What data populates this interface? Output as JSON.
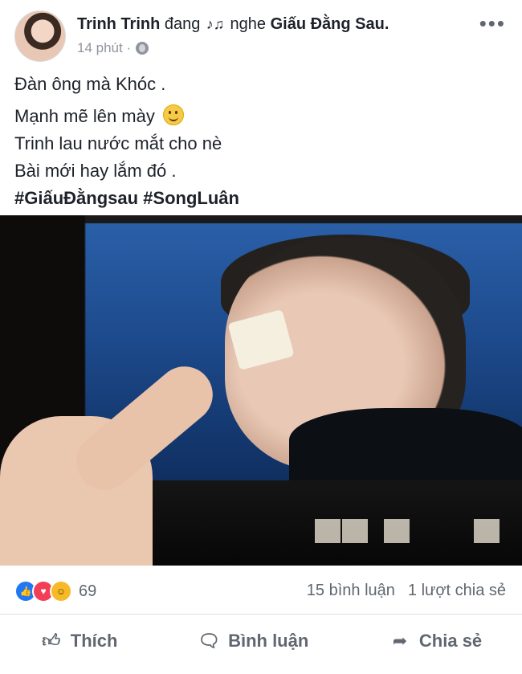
{
  "post": {
    "author": "Trinh Trinh",
    "activity_verb": "đang",
    "activity_text": "nghe",
    "song": "Giấu Đằng Sau.",
    "time": "14 phút ·",
    "more_label": "•••",
    "text_lines": [
      "Đàn ông mà Khóc .",
      "Mạnh mẽ lên mày",
      "Trinh lau nước mắt cho nè",
      "Bài mới hay lắm đó .",
      "#GiấuĐằngsau #SongLuân"
    ]
  },
  "stats": {
    "reaction_count": "69",
    "comments": "15 bình luận",
    "shares": "1 lượt chia sẻ"
  },
  "actions": {
    "like": "Thích",
    "comment": "Bình luận",
    "share": "Chia sẻ"
  },
  "icons": [
    "music-note-icon",
    "globe-icon",
    "smile-emoji-icon",
    "like-reaction-icon",
    "love-reaction-icon",
    "haha-reaction-icon",
    "thumbs-up-icon",
    "comment-bubble-icon",
    "share-arrow-icon"
  ],
  "colors": {
    "text": "#1d2129",
    "secondary_text": "#606770",
    "meta_text": "#90949c",
    "like_blue": "#2078f4",
    "love_red": "#f33e58",
    "haha_yellow": "#f7b928"
  }
}
